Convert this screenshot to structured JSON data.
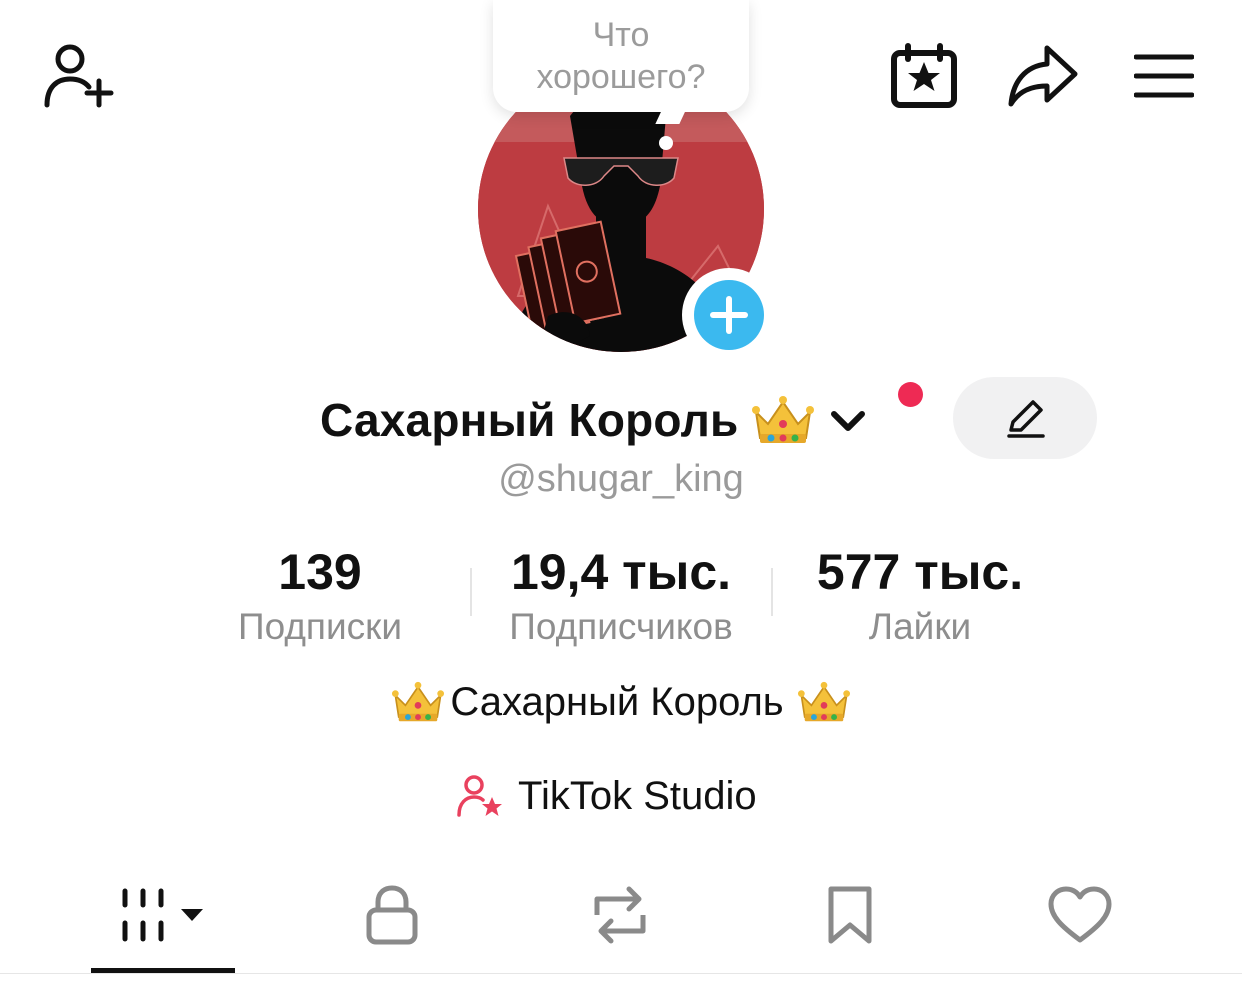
{
  "header": {
    "add_friend_icon": "person-plus-icon",
    "calendar_icon": "calendar-star-icon",
    "share_icon": "share-arrow-icon",
    "menu_icon": "hamburger-menu-icon"
  },
  "bubble": {
    "text": "Что хорошего?"
  },
  "profile": {
    "display_name": "Сахарный Король",
    "username": "@shugar_king",
    "name_emoji": "crown-emoji",
    "edit_icon": "pencil-icon"
  },
  "stats": [
    {
      "value": "139",
      "label": "Подписки"
    },
    {
      "value": "19,4 тыс.",
      "label": "Подписчиков"
    },
    {
      "value": "577 тыс.",
      "label": "Лайки"
    }
  ],
  "bio": {
    "text": "Сахарный Король"
  },
  "studio": {
    "label": "TikTok Studio",
    "icon": "person-star-icon"
  },
  "tabs": [
    {
      "icon": "grid-videos-icon",
      "active": true
    },
    {
      "icon": "lock-icon",
      "active": false
    },
    {
      "icon": "repost-icon",
      "active": false
    },
    {
      "icon": "bookmark-icon",
      "active": false
    },
    {
      "icon": "heart-icon",
      "active": false
    }
  ],
  "colors": {
    "accent_blue": "#3bb9ef",
    "notify_red": "#ee2a54",
    "studio_pink": "#e9415e",
    "avatar_red": "#b9343a"
  }
}
